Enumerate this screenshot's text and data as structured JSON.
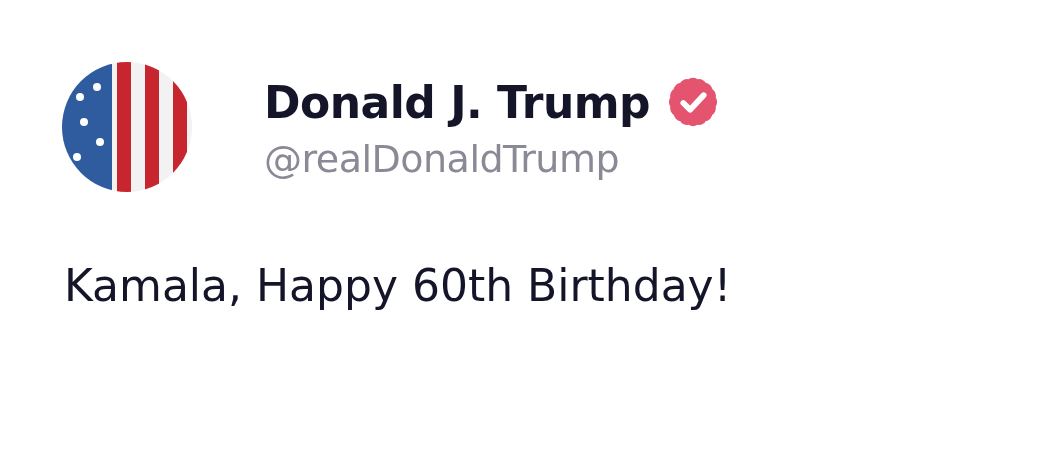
{
  "author": {
    "name": "Donald J. Trump",
    "handle": "@realDonaldTrump",
    "verified": true
  },
  "post": {
    "text": "Kamala, Happy 60th Birthday!"
  }
}
